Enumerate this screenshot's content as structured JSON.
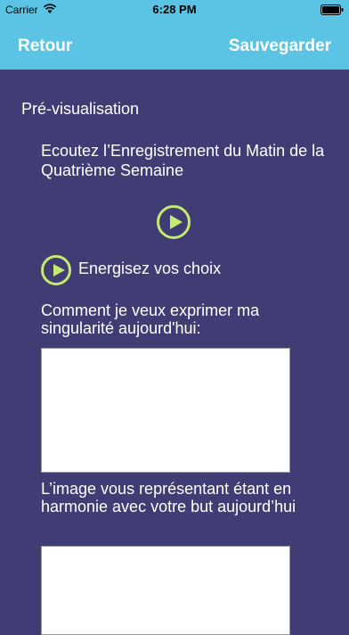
{
  "status_bar": {
    "carrier": "Carrier",
    "time": "6:28 PM"
  },
  "nav": {
    "back_label": "Retour",
    "save_label": "Sauvegarder"
  },
  "content": {
    "preview_label": "Pré-visualisation",
    "recording_title": "Ecoutez l’Enregistrement du Matin de la Quatrième Semaine",
    "energize_label": "Energisez vos choix",
    "question1_label": "Comment je veux exprimer ma singularité aujourd'hui:",
    "question1_value": "",
    "question2_label": "L’image vous représentant étant en harmonie avec votre but  aujourd’hui",
    "question2_value": ""
  },
  "colors": {
    "header_bg": "#5bc4e5",
    "page_bg": "#3f3d73",
    "play_accent": "#c6e96f"
  },
  "icons": {
    "wifi": "wifi-icon",
    "battery": "battery-icon",
    "play": "play-icon"
  }
}
